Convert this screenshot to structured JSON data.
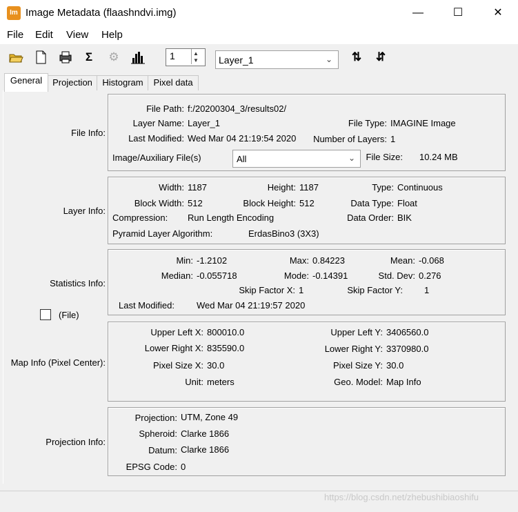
{
  "window": {
    "title": "Image Metadata (flaashndvi.img)",
    "app_icon_text": "Im"
  },
  "menu": [
    "File",
    "Edit",
    "View",
    "Help"
  ],
  "toolbar": {
    "layer_number": "1",
    "layer_select": "Layer_1"
  },
  "tabs": [
    "General",
    "Projection",
    "Histogram",
    "Pixel data"
  ],
  "file_info": {
    "group_label": "File Info:",
    "file_path_label": "File Path:",
    "file_path": "f:/20200304_3/results02/",
    "layer_name_label": "Layer Name:",
    "layer_name": "Layer_1",
    "file_type_label": "File Type:",
    "file_type": "IMAGINE Image",
    "last_modified_label": "Last Modified:",
    "last_modified": "Wed Mar 04 21:19:54 2020",
    "num_layers_label": "Number of Layers:",
    "num_layers": "1",
    "aux_label": "Image/Auxiliary File(s)",
    "aux_value": "All",
    "file_size_label": "File Size:",
    "file_size": "10.24 MB"
  },
  "layer_info": {
    "group_label": "Layer Info:",
    "width_label": "Width:",
    "width": "1187",
    "height_label": "Height:",
    "height": "1187",
    "type_label": "Type:",
    "type": "Continuous",
    "block_width_label": "Block Width:",
    "block_width": "512",
    "block_height_label": "Block Height:",
    "block_height": "512",
    "data_type_label": "Data Type:",
    "data_type": "Float",
    "compression_label": "Compression:",
    "compression": "Run Length Encoding",
    "data_order_label": "Data Order:",
    "data_order": "BIK",
    "pyramid_label": "Pyramid Layer Algorithm:",
    "pyramid": "ErdasBino3 (3X3)"
  },
  "statistics_info": {
    "group_label": "Statistics Info:",
    "min_label": "Min:",
    "min": "-1.2102",
    "max_label": "Max:",
    "max": "0.84223",
    "mean_label": "Mean:",
    "mean": "-0.068",
    "median_label": "Median:",
    "median": "-0.055718",
    "mode_label": "Mode:",
    "mode": "-0.14391",
    "std_label": "Std. Dev:",
    "std": "0.276",
    "skip_x_label": "Skip Factor X:",
    "skip_x": "1",
    "skip_y_label": "Skip Factor Y:",
    "skip_y": "1",
    "last_modified_label": "Last Modified:",
    "last_modified": "Wed Mar 04 21:19:57 2020",
    "file_checkbox_label": "(File)"
  },
  "map_info": {
    "group_label": "Map Info (Pixel Center):",
    "ulx_label": "Upper Left X:",
    "ulx": "800010.0",
    "uly_label": "Upper Left Y:",
    "uly": "3406560.0",
    "lrx_label": "Lower Right X:",
    "lrx": "835590.0",
    "lry_label": "Lower Right Y:",
    "lry": "3370980.0",
    "psx_label": "Pixel Size X:",
    "psx": "30.0",
    "psy_label": "Pixel Size Y:",
    "psy": "30.0",
    "unit_label": "Unit:",
    "unit": "meters",
    "geo_label": "Geo. Model:",
    "geo": "Map Info"
  },
  "projection_info": {
    "group_label": "Projection Info:",
    "projection_label": "Projection:",
    "projection": "UTM, Zone 49",
    "spheroid_label": "Spheroid:",
    "spheroid": "Clarke 1866",
    "datum_label": "Datum:",
    "datum": "Clarke 1866",
    "epsg_label": "EPSG Code:",
    "epsg": "0"
  },
  "watermark": "https://blog.csdn.net/zhebushibiaoshifu"
}
